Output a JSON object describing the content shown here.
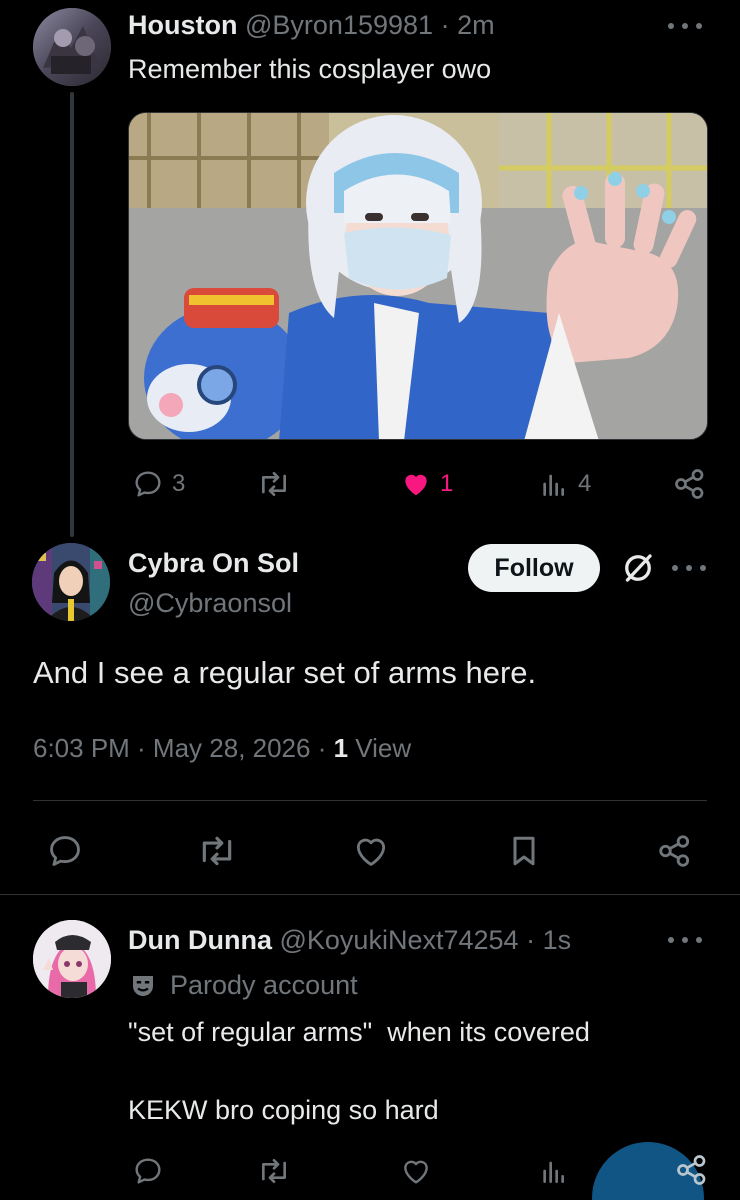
{
  "tweet1": {
    "display_name": "Houston",
    "handle": "@Byron159981",
    "separator": "·",
    "time": "2m",
    "text": "Remember this cosplayer owo",
    "actions": {
      "replies": "3",
      "likes": "1",
      "views": "4"
    },
    "like_color": "#f91880"
  },
  "tweet2": {
    "display_name": "Cybra On Sol",
    "handle": "@Cybraonsol",
    "follow_label": "Follow",
    "text": "And I see a regular set of arms here.",
    "timestamp": "6:03 PM · May 28, 2026 · ",
    "view_count": "1",
    "view_label": " View"
  },
  "tweet3": {
    "display_name": "Dun Dunna",
    "handle": "@KoyukiNext74254",
    "separator": "·",
    "time": "1s",
    "parody_label": "Parody account",
    "text_line1": "\"set of regular arms\"  when its covered",
    "text_line2": "KEKW bro coping so hard"
  },
  "colors": {
    "background": "#000000",
    "text": "#e7e9ea",
    "muted": "#71767b",
    "accent": "#1d9bf0"
  }
}
